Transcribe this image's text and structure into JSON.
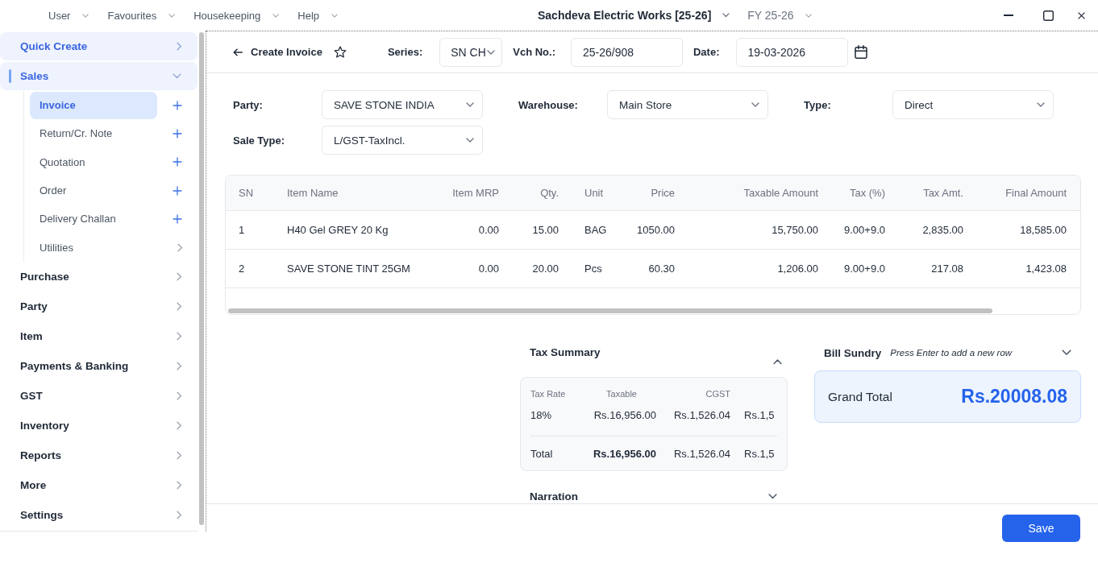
{
  "menu_bar": {
    "items": [
      "User",
      "Favourites",
      "Housekeeping",
      "Help"
    ],
    "company": "Sachdeva Electric Works [25-26]",
    "financial_year": "FY 25-26"
  },
  "sidebar": {
    "items": [
      {
        "label": "Quick Create",
        "highlighted": true,
        "expanded": false
      },
      {
        "label": "Sales",
        "highlighted": true,
        "expanded": true,
        "children": [
          {
            "label": "Invoice",
            "kind": "add",
            "selected": true
          },
          {
            "label": "Return/Cr. Note",
            "kind": "add",
            "selected": false
          },
          {
            "label": "Quotation",
            "kind": "add",
            "selected": false
          },
          {
            "label": "Order",
            "kind": "add",
            "selected": false
          },
          {
            "label": "Delivery Challan",
            "kind": "add",
            "selected": false
          },
          {
            "label": "Utilities",
            "kind": "submenu",
            "selected": false
          }
        ]
      },
      {
        "label": "Purchase",
        "highlighted": false,
        "expanded": false
      },
      {
        "label": "Party",
        "highlighted": false,
        "expanded": false
      },
      {
        "label": "Item",
        "highlighted": false,
        "expanded": false
      },
      {
        "label": "Payments & Banking",
        "highlighted": false,
        "expanded": false
      },
      {
        "label": "GST",
        "highlighted": false,
        "expanded": false
      },
      {
        "label": "Inventory",
        "highlighted": false,
        "expanded": false
      },
      {
        "label": "Reports",
        "highlighted": false,
        "expanded": false
      },
      {
        "label": "More",
        "highlighted": false,
        "expanded": false
      },
      {
        "label": "Settings",
        "highlighted": false,
        "expanded": false
      }
    ]
  },
  "invoice": {
    "header": {
      "title": "Create Invoice",
      "favourite": false,
      "series": {
        "label": "Series:",
        "value": "SN CH"
      },
      "voucher_no": {
        "label": "Vch No.:",
        "value": "25-26/908"
      },
      "date": {
        "label": "Date:",
        "value": "19-03-2026"
      }
    },
    "fields": [
      {
        "label": "Party:",
        "value": "SAVE STONE INDIA"
      },
      {
        "label": "Warehouse:",
        "value": "Main Store"
      },
      {
        "label": "Type:",
        "value": "Direct"
      },
      {
        "label": "Sale Type:",
        "value": "L/GST-TaxIncl."
      }
    ],
    "items_table": {
      "columns": [
        "SN",
        "Item Name",
        "Item MRP",
        "Qty.",
        "Unit",
        "Price",
        "Taxable Amount",
        "Tax (%)",
        "Tax Amt.",
        "Final Amount"
      ],
      "rows": [
        [
          "1",
          "H40 Gel GREY 20 Kg",
          "0.00",
          "15.00",
          "BAG",
          "1050.00",
          "15,750.00",
          "9.00+9.0",
          "2,835.00",
          "18,585.00"
        ],
        [
          "2",
          "SAVE STONE TINT 25GM",
          "0.00",
          "20.00",
          "Pcs",
          "60.30",
          "1,206.00",
          "9.00+9.0",
          "217.08",
          "1,423.08"
        ]
      ]
    },
    "tax_summary": {
      "title": "Tax Summary",
      "expanded": true,
      "columns": [
        "Tax Rate",
        "Taxable",
        "CGST"
      ],
      "rows": [
        [
          "18%",
          "Rs.16,956.00",
          "Rs.1,526.04",
          "Rs.1,5"
        ]
      ],
      "total": [
        "Total",
        "Rs.16,956.00",
        "Rs.1,526.04",
        "Rs.1,5"
      ]
    },
    "narration": {
      "title": "Narration",
      "expanded": false
    },
    "bill_sundry": {
      "title": "Bill Sundry",
      "hint": "Press Enter to add a new row",
      "expanded": false
    },
    "grand_total": {
      "label": "Grand Total",
      "value": "Rs.20008.08"
    }
  },
  "footer": {
    "save_button": "Save"
  }
}
